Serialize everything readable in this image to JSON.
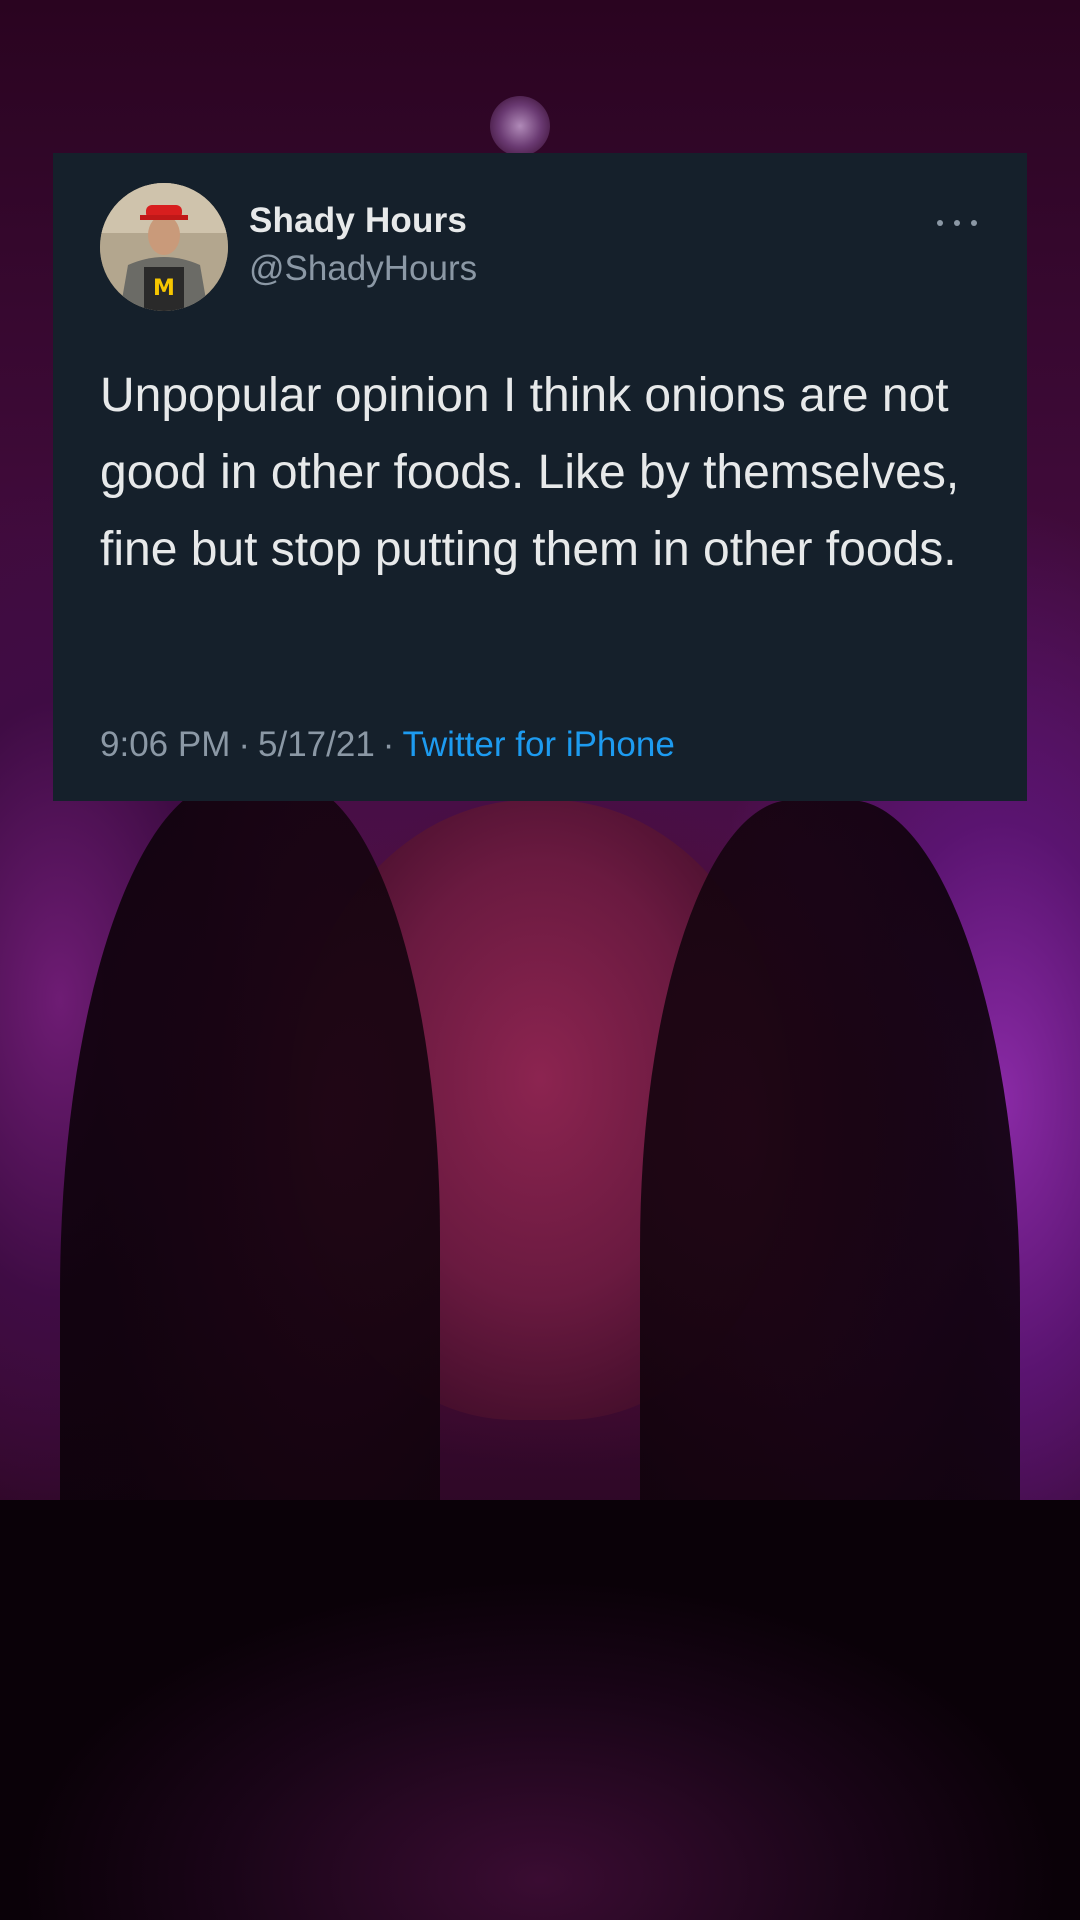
{
  "tweet": {
    "display_name": "Shady Hours",
    "handle": "@ShadyHours",
    "text": "Unpopular opinion I think onions are not good in other foods. Like by themselves, fine but stop putting them in other foods.",
    "time": "9:06 PM",
    "separator": "·",
    "date": "5/17/21",
    "source": "Twitter for iPhone"
  },
  "colors": {
    "card_background": "#15202b",
    "primary_text": "#e7e9ea",
    "secondary_text": "#8b98a5",
    "link": "#1d9bf0"
  },
  "icons": {
    "more": "more-horizontal-icon"
  }
}
